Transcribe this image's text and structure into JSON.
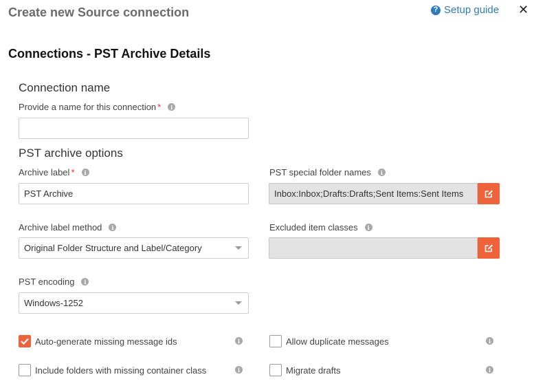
{
  "header": {
    "title": "Create new Source connection",
    "setup_guide_label": "Setup guide",
    "close_glyph": "✕"
  },
  "section": {
    "title": "Connections - PST Archive Details"
  },
  "connection_name": {
    "heading": "Connection name",
    "name_label": "Provide a name for this connection",
    "name_value": ""
  },
  "pst_options": {
    "heading": "PST archive options",
    "archive_label": {
      "label": "Archive label",
      "value": "PST Archive"
    },
    "special_folders": {
      "label": "PST special folder names",
      "value": "Inbox:Inbox;Drafts:Drafts;Sent Items:Sent Items"
    },
    "label_method": {
      "label": "Archive label method",
      "selected": "Original Folder Structure and Label/Category"
    },
    "excluded_classes": {
      "label": "Excluded item classes",
      "value": ""
    },
    "encoding": {
      "label": "PST encoding",
      "selected": "Windows-1252"
    }
  },
  "checkboxes": [
    {
      "label": "Auto-generate missing message ids",
      "checked": true
    },
    {
      "label": "Allow duplicate messages",
      "checked": false
    },
    {
      "label": "Include folders with missing container class",
      "checked": false
    },
    {
      "label": "Migrate drafts",
      "checked": false
    }
  ],
  "common": {
    "required_mark": "*",
    "info_glyph": "i",
    "help_glyph": "?"
  },
  "colors": {
    "accent": "#f0623a",
    "link": "#2e7cb8"
  }
}
